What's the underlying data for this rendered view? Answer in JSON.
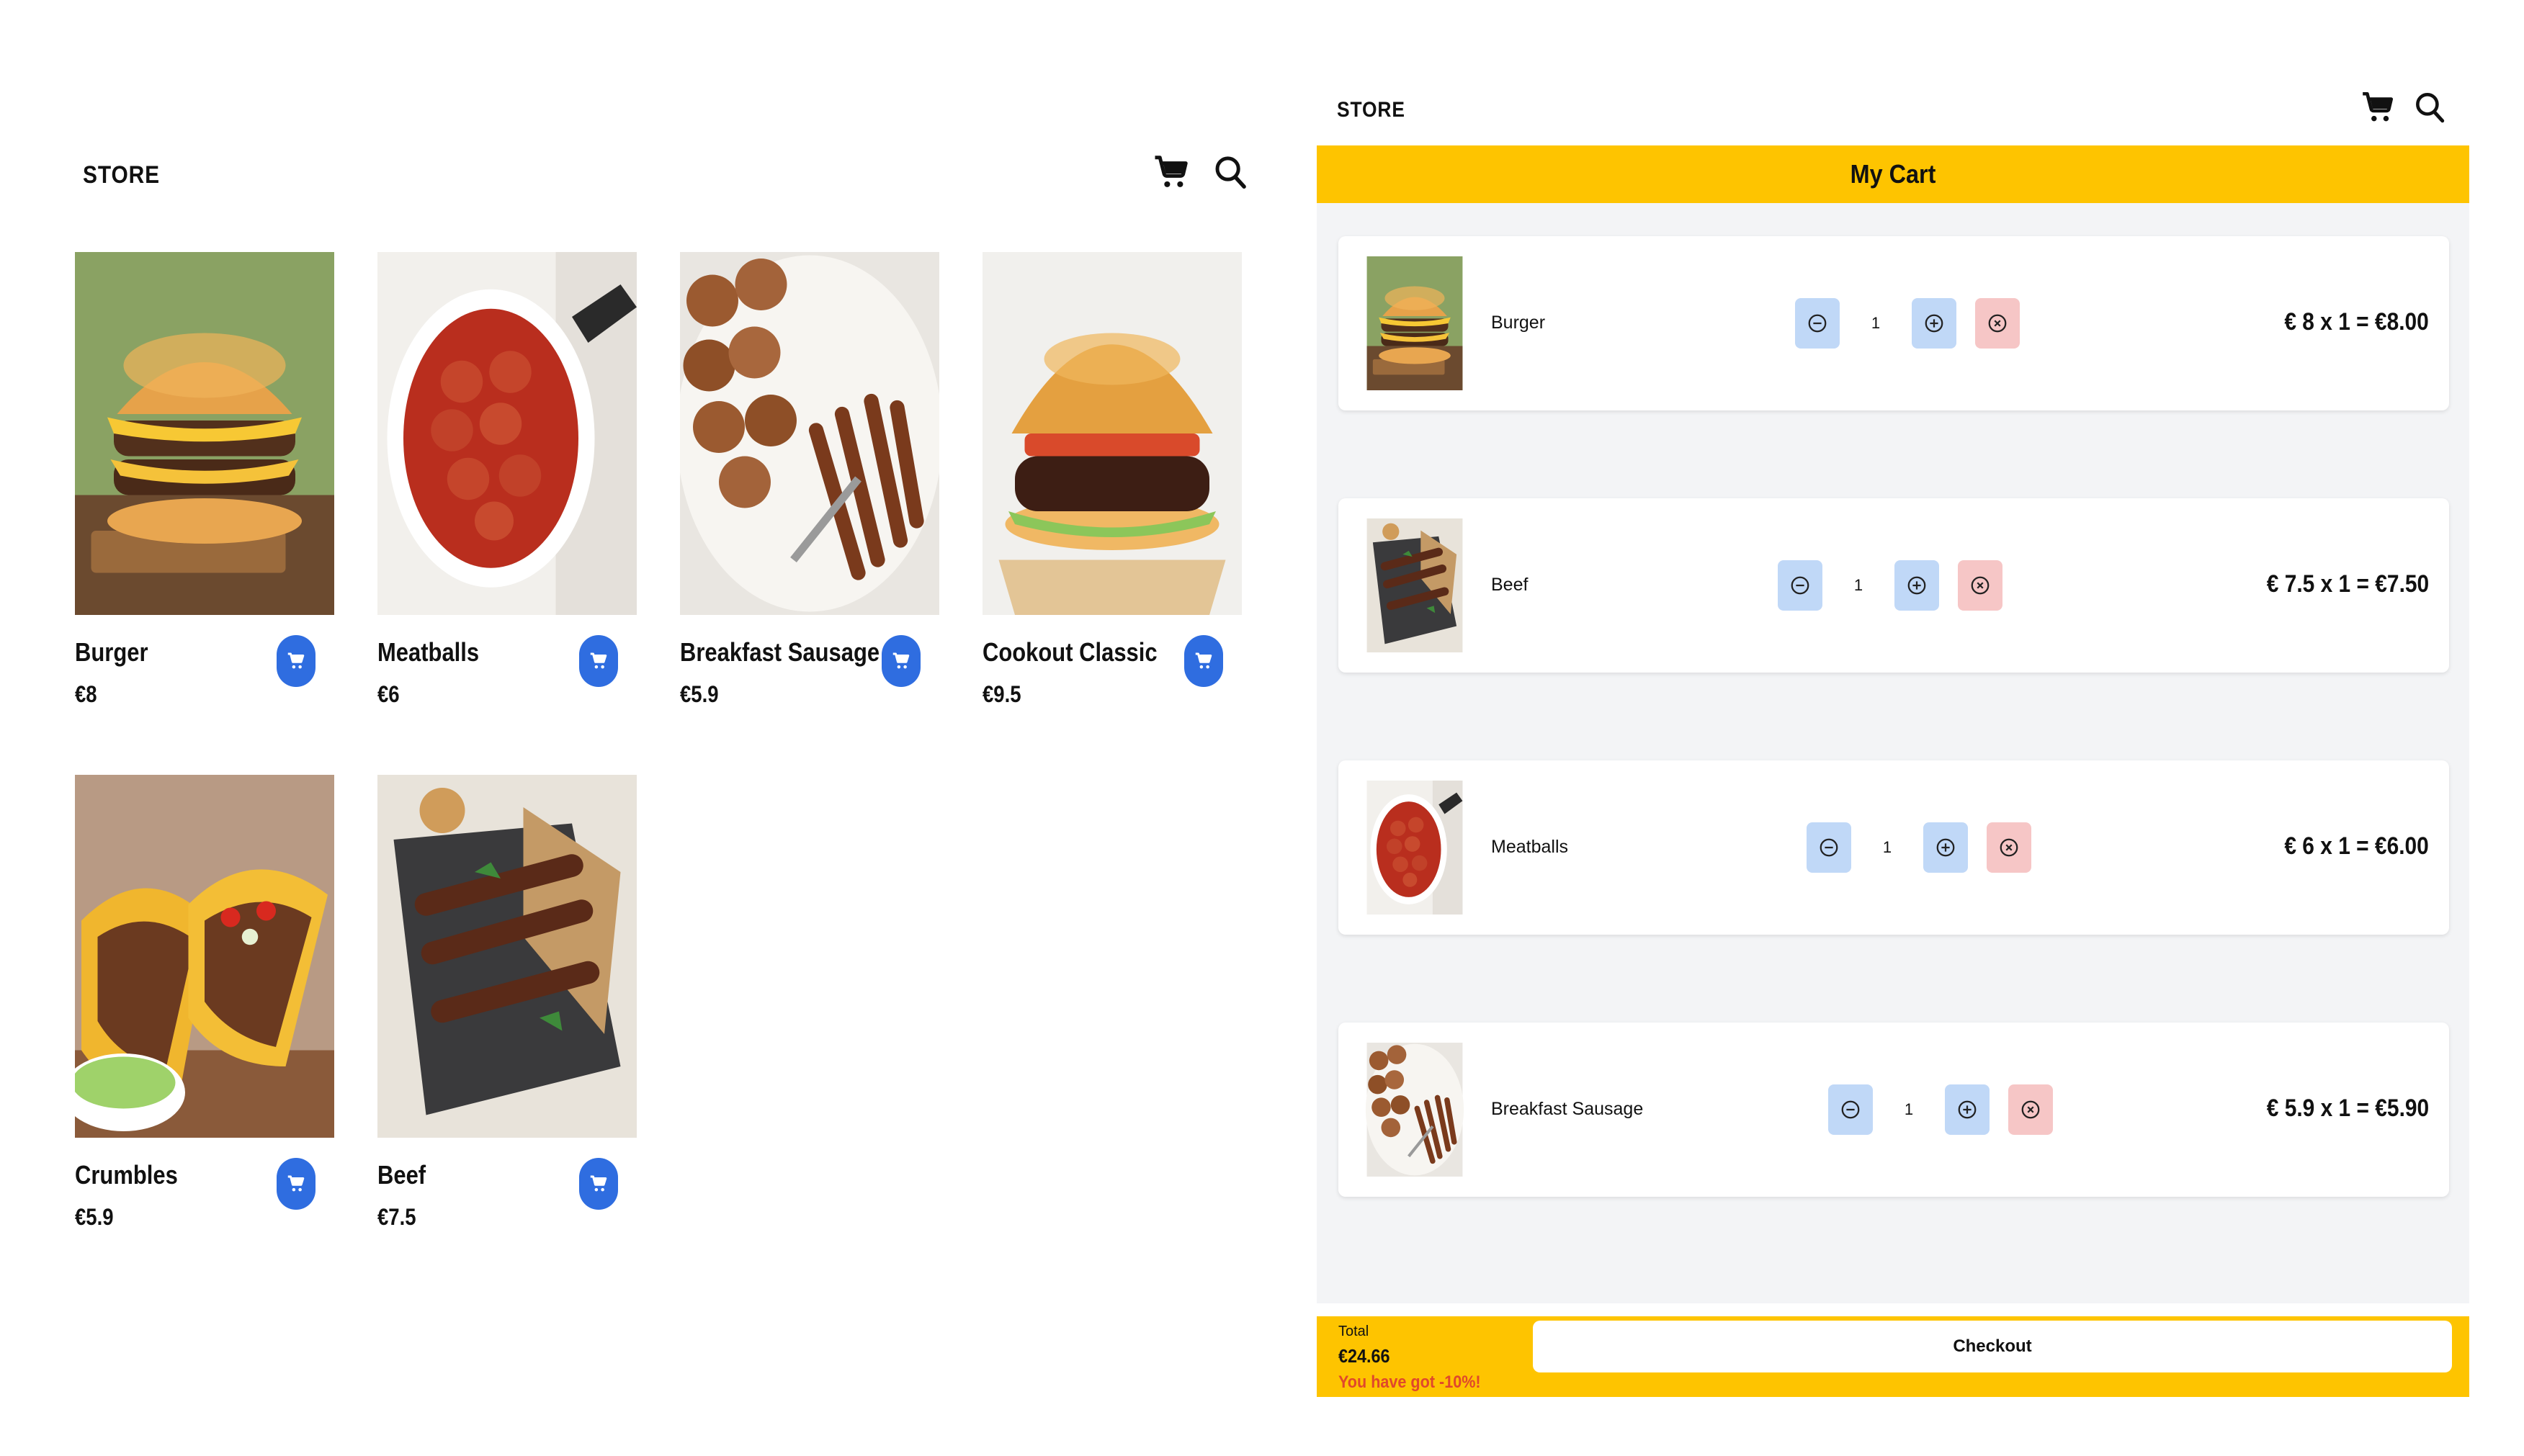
{
  "store": {
    "brand": "STORE",
    "icons": [
      "cart-icon",
      "search-icon"
    ],
    "products": [
      {
        "name": "Burger",
        "price": "€8",
        "image": "burger"
      },
      {
        "name": "Meatballs",
        "price": "€6",
        "image": "meatballs"
      },
      {
        "name": "Breakfast Sausage",
        "price": "€5.9",
        "image": "sausage"
      },
      {
        "name": "Cookout Classic",
        "price": "€9.5",
        "image": "cookout"
      },
      {
        "name": "Crumbles",
        "price": "€5.9",
        "image": "tacos"
      },
      {
        "name": "Beef",
        "price": "€7.5",
        "image": "beef"
      }
    ]
  },
  "cart": {
    "brand": "STORE",
    "title": "My Cart",
    "items": [
      {
        "name": "Burger",
        "qty": "1",
        "line": "€ 8 x 1 = €8.00"
      },
      {
        "name": "Beef",
        "qty": "1",
        "line": "€ 7.5 x 1 = €7.50"
      },
      {
        "name": "Meatballs",
        "qty": "1",
        "line": "€ 6 x 1 = €6.00"
      },
      {
        "name": "Breakfast Sausage",
        "qty": "1",
        "line": "€ 5.9 x 1 = €5.90"
      }
    ],
    "total_label": "Total",
    "total_value": "€24.66",
    "discount_text": "You have got -10%!",
    "checkout_label": "Checkout"
  },
  "colors": {
    "accent": "#fec400",
    "add_button": "#2f6de0",
    "qty_button": "#c0d8f7",
    "remove_button": "#f6c6c6",
    "discount": "#e0482b",
    "cart_background": "#f3f4f6"
  }
}
